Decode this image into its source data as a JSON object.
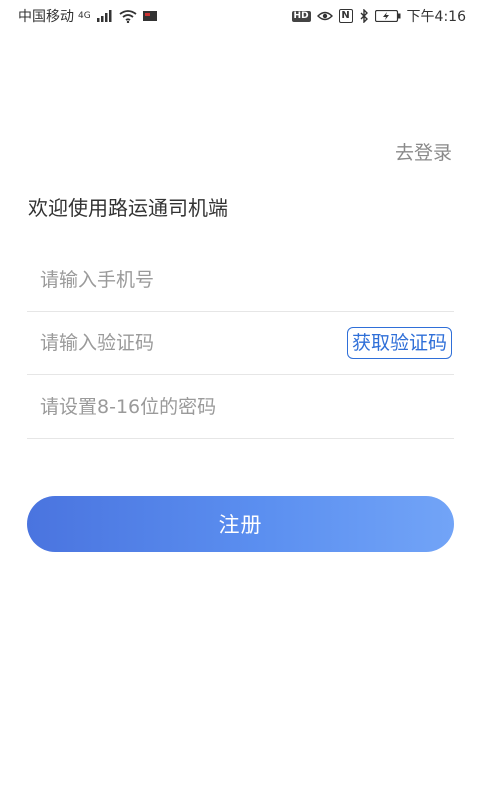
{
  "status_bar": {
    "carrier": "中国移动",
    "network": "4G",
    "hd_badge": "HD",
    "nfc": "N",
    "time": "下午4:16",
    "icons": [
      "signal-icon",
      "wifi-icon",
      "notification-icon",
      "hd-icon",
      "eye-icon",
      "nfc-icon",
      "bluetooth-icon",
      "battery-icon"
    ]
  },
  "header": {
    "login_link": "去登录"
  },
  "welcome_text": "欢迎使用路运通司机端",
  "form": {
    "phone_placeholder": "请输入手机号",
    "phone_value": "",
    "code_placeholder": "请输入验证码",
    "code_value": "",
    "get_code_label": "获取验证码",
    "password_placeholder": "请设置8-16位的密码",
    "password_value": ""
  },
  "register_label": "注册",
  "colors": {
    "accent": "#2f6fd8",
    "button_gradient_start": "#4a74df",
    "button_gradient_end": "#72a4f7",
    "muted_text": "#8a8a8a",
    "divider": "#e6e6e6"
  }
}
